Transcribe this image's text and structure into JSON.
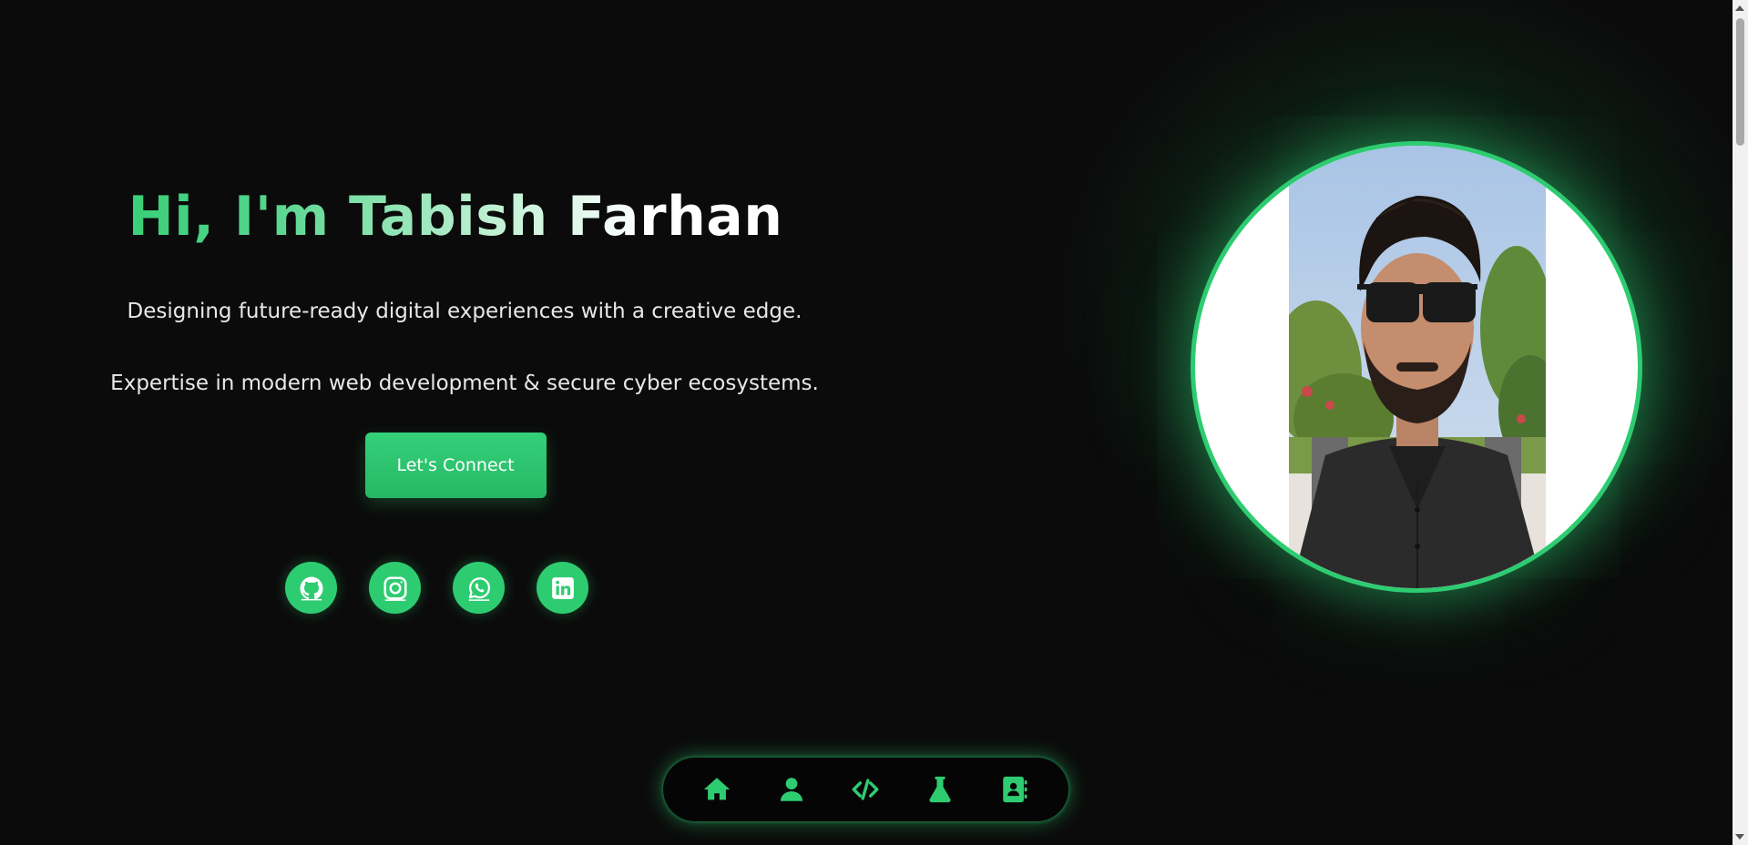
{
  "hero": {
    "title": "Hi, I'm Tabish Farhan",
    "description_1": "Designing future-ready digital experiences with a creative edge.",
    "description_2": "Expertise in modern web development & secure cyber ecosystems.",
    "cta_label": "Let's Connect"
  },
  "socials": [
    {
      "name": "github",
      "icon": "github-icon"
    },
    {
      "name": "instagram",
      "icon": "instagram-icon"
    },
    {
      "name": "whatsapp",
      "icon": "whatsapp-icon"
    },
    {
      "name": "linkedin",
      "icon": "linkedin-icon"
    }
  ],
  "profile": {
    "image": "profile-photo"
  },
  "dock": {
    "items": [
      {
        "icon": "home-icon"
      },
      {
        "icon": "user-icon"
      },
      {
        "icon": "code-icon"
      },
      {
        "icon": "flask-icon"
      },
      {
        "icon": "contact-book-icon"
      }
    ]
  },
  "colors": {
    "accent": "#2ecc71",
    "background": "#0b0b0b",
    "text": "#e8e8e8"
  }
}
